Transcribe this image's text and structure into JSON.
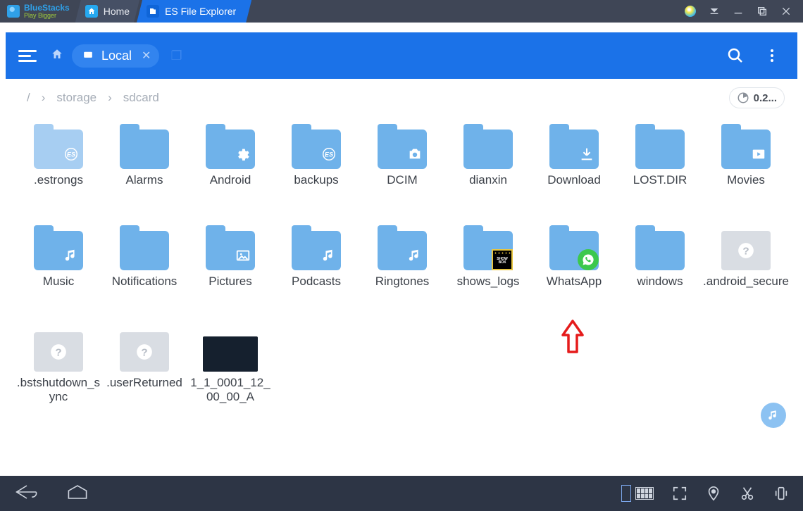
{
  "titlebar": {
    "logo": {
      "title": "BlueStacks",
      "subtitle": "Play Bigger"
    },
    "tabs": [
      {
        "label": "Home",
        "icon": "home",
        "active": false
      },
      {
        "label": "ES File Explorer",
        "icon": "es",
        "active": true
      }
    ]
  },
  "header": {
    "pill_label": "Local",
    "windows_glyph": "❐"
  },
  "breadcrumb": {
    "root": "/",
    "items": [
      "storage",
      "sdcard"
    ],
    "storage_indicator": "0.2..."
  },
  "items": [
    {
      "name": ".estrongs",
      "type": "folder",
      "variant": "faded",
      "overlay": "es-round"
    },
    {
      "name": "Alarms",
      "type": "folder",
      "overlay": "none"
    },
    {
      "name": "Android",
      "type": "folder",
      "overlay": "gear"
    },
    {
      "name": "backups",
      "type": "folder",
      "overlay": "es-round"
    },
    {
      "name": "DCIM",
      "type": "folder",
      "overlay": "camera"
    },
    {
      "name": "dianxin",
      "type": "folder",
      "overlay": "none"
    },
    {
      "name": "Download",
      "type": "folder",
      "overlay": "download"
    },
    {
      "name": "LOST.DIR",
      "type": "folder",
      "overlay": "none"
    },
    {
      "name": "Movies",
      "type": "folder",
      "overlay": "play"
    },
    {
      "name": "Music",
      "type": "folder",
      "overlay": "music"
    },
    {
      "name": "Notifications",
      "type": "folder",
      "overlay": "none"
    },
    {
      "name": "Pictures",
      "type": "folder",
      "overlay": "image"
    },
    {
      "name": "Podcasts",
      "type": "folder",
      "overlay": "music"
    },
    {
      "name": "Ringtones",
      "type": "folder",
      "overlay": "music"
    },
    {
      "name": "shows_logs",
      "type": "folder",
      "overlay": "none",
      "badge": "showbox"
    },
    {
      "name": "WhatsApp",
      "type": "folder",
      "overlay": "none",
      "badge": "whatsapp"
    },
    {
      "name": "windows",
      "type": "folder",
      "overlay": "none"
    },
    {
      "name": ".android_secure",
      "type": "file-unknown"
    },
    {
      "name": ".bstshutdown_sync",
      "type": "file-unknown"
    },
    {
      "name": ".userReturned",
      "type": "file-unknown"
    },
    {
      "name": "1_1_0001_12_00_00_A",
      "type": "file-dark"
    }
  ],
  "badges": {
    "showbox_line1": "SHOW",
    "showbox_line2": "BOX"
  },
  "annotation": {
    "target": "WhatsApp"
  },
  "colors": {
    "folder": "#6fb2ea",
    "header": "#1b72e8",
    "titlebar": "#3f4656"
  }
}
